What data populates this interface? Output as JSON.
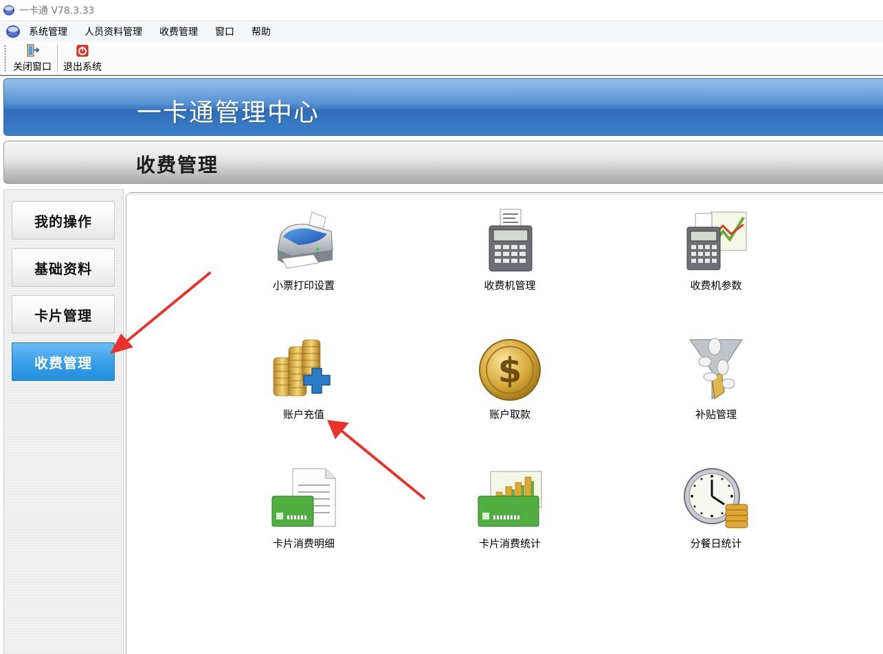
{
  "window": {
    "title": "一卡通 V78.3.33",
    "icon": "app-logo-icon"
  },
  "menubar": {
    "icon": "menu-logo-icon",
    "items": [
      "系统管理",
      "人员资料管理",
      "收费管理",
      "窗口",
      "帮助"
    ]
  },
  "toolbar": {
    "buttons": [
      {
        "label": "关闭窗口",
        "icon": "close-window-icon"
      },
      {
        "label": "退出系统",
        "icon": "exit-system-icon"
      }
    ]
  },
  "banner": {
    "title": "一卡通管理中心"
  },
  "section": {
    "title": "收费管理"
  },
  "sidebar": {
    "items": [
      {
        "label": "我的操作",
        "active": false
      },
      {
        "label": "基础资料",
        "active": false
      },
      {
        "label": "卡片管理",
        "active": false
      },
      {
        "label": "收费管理",
        "active": true
      }
    ]
  },
  "tiles": [
    {
      "label": "小票打印设置",
      "icon": "printer-icon"
    },
    {
      "label": "收费机管理",
      "icon": "pos-terminal-icon"
    },
    {
      "label": "收费机参数",
      "icon": "pos-chart-icon"
    },
    {
      "label": "账户充值",
      "icon": "coins-plus-icon"
    },
    {
      "label": "账户取款",
      "icon": "dollar-coin-icon"
    },
    {
      "label": "补贴管理",
      "icon": "funnel-coins-icon"
    },
    {
      "label": "卡片消费明细",
      "icon": "card-document-icon"
    },
    {
      "label": "卡片消费统计",
      "icon": "card-barchart-icon"
    },
    {
      "label": "分餐日统计",
      "icon": "clock-coins-icon"
    }
  ],
  "colors": {
    "banner": "#3e82cd",
    "active_tab": "#3aa0e9",
    "arrow": "#e8322c"
  }
}
